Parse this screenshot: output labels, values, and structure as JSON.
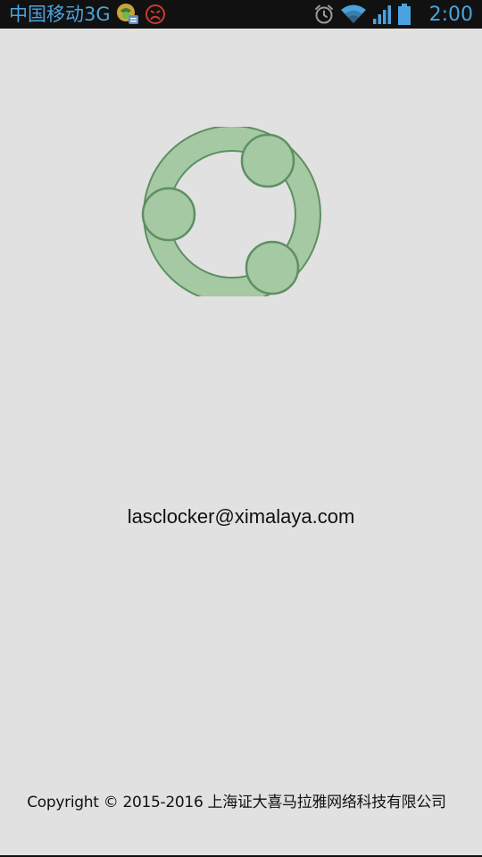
{
  "status_bar": {
    "carrier": "中国移动3G",
    "time": "2:00",
    "icons": [
      "app-notification-icon",
      "sad-face-icon",
      "alarm-icon",
      "wifi-icon",
      "signal-icon",
      "battery-icon"
    ],
    "accent_color": "#4aa3df"
  },
  "splash": {
    "logo": "ximalaya-logo-icon",
    "logo_color": "#a5c9a3",
    "email": "lasclocker@ximalaya.com",
    "copyright": "Copyright © 2015-2016 上海证大喜马拉雅网络科技有限公司"
  }
}
